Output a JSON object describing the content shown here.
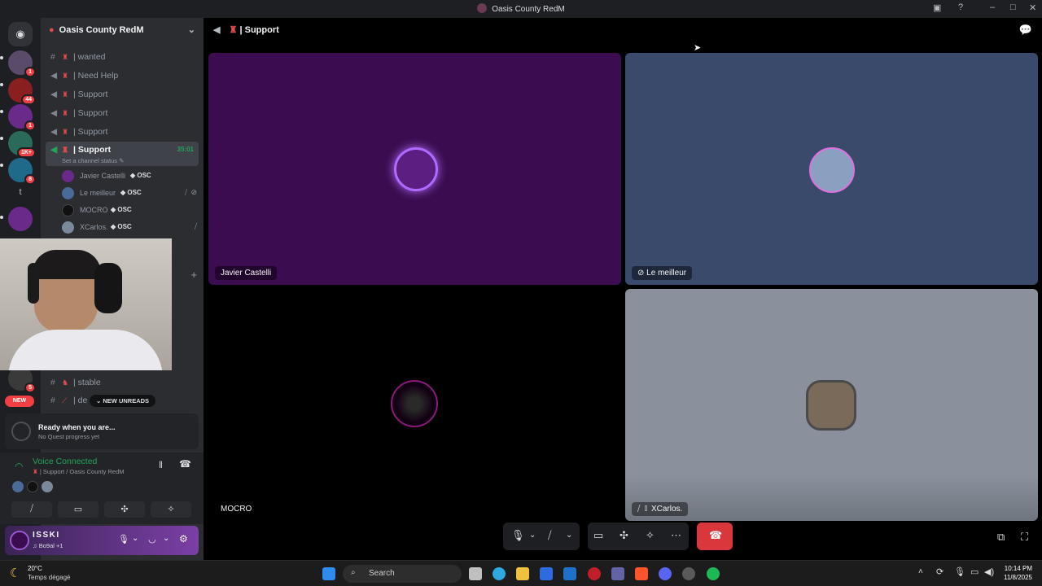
{
  "window": {
    "title": "Oasis County RedM"
  },
  "rail": {
    "badges": [
      "1",
      "44",
      "1",
      "1K+",
      "8",
      "5"
    ],
    "letter": "t",
    "new_pill": "NEW"
  },
  "guild": {
    "name": "Oasis County RedM"
  },
  "channels": [
    {
      "icon": "#",
      "name": "| wanted"
    },
    {
      "icon": "voice",
      "name": "| Need Help"
    },
    {
      "icon": "voice",
      "name": "| Support"
    },
    {
      "icon": "voice",
      "name": "| Support"
    },
    {
      "icon": "voice",
      "name": "| Support"
    }
  ],
  "active_channel": {
    "name": "| Support",
    "timer": "35:01",
    "status": "Set a channel status"
  },
  "voice_users": [
    {
      "name": "Javier Castelli",
      "tag": "OSC"
    },
    {
      "name": "Le meilleur",
      "tag": "OSC"
    },
    {
      "name": "MOCRO",
      "tag": "OSC"
    },
    {
      "name": "XCarlos.",
      "tag": "OSC"
    }
  ],
  "lower_channels": [
    {
      "name": "| stable"
    },
    {
      "name": "| de"
    }
  ],
  "new_unreads": "NEW UNREADS",
  "quest": {
    "title": "Ready when you are...",
    "subtitle": "No Quest progress yet"
  },
  "voice": {
    "status": "Voice Connected",
    "channel": "| Support / Oasis County RedM"
  },
  "user": {
    "name": "ISSKI",
    "activity": "Bo9al +1"
  },
  "call": {
    "header": "| Support",
    "tiles": [
      {
        "name": "Javier Castelli",
        "bg": "#3b0c50"
      },
      {
        "name": "Le meilleur",
        "bg": "#3a4a6b"
      },
      {
        "name": "MOCRO",
        "bg": "#000000"
      },
      {
        "name": "XCarlos.",
        "bg": "#8a919c"
      }
    ]
  },
  "taskbar": {
    "weather_temp": "20°C",
    "weather_desc": "Temps dégagé",
    "search": "Search",
    "time": "10:14 PM",
    "date": "11/8/2025"
  },
  "colors": {
    "accent": "#5865f2",
    "green": "#23a55a",
    "red": "#da373c",
    "danger_badge": "#f23f43"
  }
}
